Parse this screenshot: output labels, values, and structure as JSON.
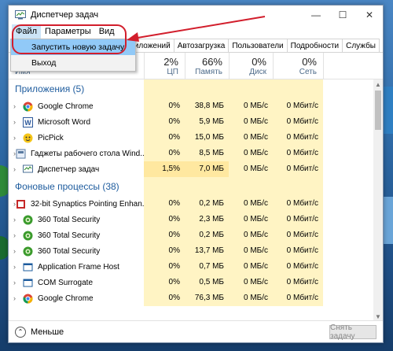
{
  "window": {
    "title": "Диспетчер задач",
    "controls": {
      "minimize": "—",
      "maximize": "☐",
      "close": "✕"
    }
  },
  "menu": {
    "items": [
      "Файл",
      "Параметры",
      "Вид"
    ],
    "dropdown": [
      "Запустить новую задачу",
      "Выход"
    ]
  },
  "tabs": [
    "рнал приложений",
    "Автозагрузка",
    "Пользователи",
    "Подробности",
    "Службы"
  ],
  "columns": {
    "name": "Имя",
    "cpu": {
      "pct": "2%",
      "label": "ЦП"
    },
    "mem": {
      "pct": "66%",
      "label": "Память"
    },
    "disk": {
      "pct": "0%",
      "label": "Диск"
    },
    "net": {
      "pct": "0%",
      "label": "Сеть"
    }
  },
  "groups": {
    "apps": "Приложения (5)",
    "background": "Фоновые процессы (38)"
  },
  "apps": [
    {
      "name": "Google Chrome",
      "icon": "chrome-icon",
      "cpu": "0%",
      "mem": "38,8 МБ",
      "disk": "0 МБ/с",
      "net": "0 Мбит/с"
    },
    {
      "name": "Microsoft Word",
      "icon": "word-icon",
      "cpu": "0%",
      "mem": "5,9 МБ",
      "disk": "0 МБ/с",
      "net": "0 Мбит/с"
    },
    {
      "name": "PicPick",
      "icon": "picpick-icon",
      "cpu": "0%",
      "mem": "15,0 МБ",
      "disk": "0 МБ/с",
      "net": "0 Мбит/с"
    },
    {
      "name": "Гаджеты рабочего стола Wind...",
      "icon": "gadgets-icon",
      "cpu": "0%",
      "mem": "8,5 МБ",
      "disk": "0 МБ/с",
      "net": "0 Мбит/с"
    },
    {
      "name": "Диспетчер задач",
      "icon": "taskmgr-icon",
      "cpu": "1,5%",
      "mem": "7,0 МБ",
      "disk": "0 МБ/с",
      "net": "0 Мбит/с"
    }
  ],
  "background": [
    {
      "name": "32-bit Synaptics Pointing Enhan...",
      "icon": "synaptics-icon",
      "cpu": "0%",
      "mem": "0,2 МБ",
      "disk": "0 МБ/с",
      "net": "0 Мбит/с"
    },
    {
      "name": "360 Total Security",
      "icon": "security-icon",
      "cpu": "0%",
      "mem": "2,3 МБ",
      "disk": "0 МБ/с",
      "net": "0 Мбит/с"
    },
    {
      "name": "360 Total Security",
      "icon": "security-icon",
      "cpu": "0%",
      "mem": "0,2 МБ",
      "disk": "0 МБ/с",
      "net": "0 Мбит/с"
    },
    {
      "name": "360 Total Security",
      "icon": "security-icon",
      "cpu": "0%",
      "mem": "13,7 МБ",
      "disk": "0 МБ/с",
      "net": "0 Мбит/с"
    },
    {
      "name": "Application Frame Host",
      "icon": "app-frame-icon",
      "cpu": "0%",
      "mem": "0,7 МБ",
      "disk": "0 МБ/с",
      "net": "0 Мбит/с"
    },
    {
      "name": "COM Surrogate",
      "icon": "com-icon",
      "cpu": "0%",
      "mem": "0,5 МБ",
      "disk": "0 МБ/с",
      "net": "0 Мбит/с"
    },
    {
      "name": "Google Chrome",
      "icon": "chrome-icon",
      "cpu": "0%",
      "mem": "76,3 МБ",
      "disk": "0 МБ/с",
      "net": "0 Мбит/с"
    }
  ],
  "footer": {
    "less": "Меньше",
    "end_task": "Снять задачу"
  },
  "colors": {
    "accent": "#1e5c9e",
    "annotation": "#d21e2c",
    "cell_bg": "#fff4c4"
  }
}
